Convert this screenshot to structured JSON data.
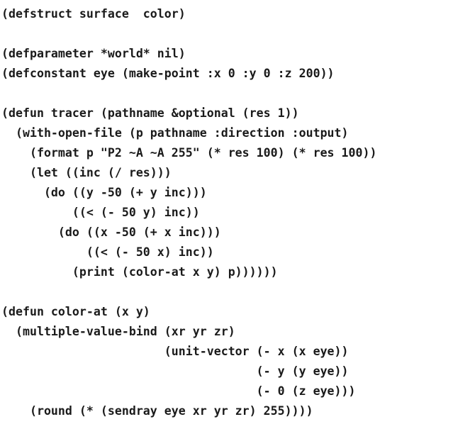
{
  "document": {
    "lines": [
      "(defstruct surface  color)",
      "",
      "(defparameter *world* nil)",
      "(defconstant eye (make-point :x 0 :y 0 :z 200))",
      "",
      "(defun tracer (pathname &optional (res 1))",
      "  (with-open-file (p pathname :direction :output)",
      "    (format p \"P2 ~A ~A 255\" (* res 100) (* res 100))",
      "    (let ((inc (/ res)))",
      "      (do ((y -50 (+ y inc)))",
      "          ((< (- 50 y) inc))",
      "        (do ((x -50 (+ x inc)))",
      "            ((< (- 50 x) inc))",
      "          (print (color-at x y) p))))))",
      "",
      "(defun color-at (x y)",
      "  (multiple-value-bind (xr yr zr)",
      "                       (unit-vector (- x (x eye))",
      "                                    (- y (y eye))",
      "                                    (- 0 (z eye)))",
      "    (round (* (sendray eye xr yr zr) 255))))"
    ]
  }
}
